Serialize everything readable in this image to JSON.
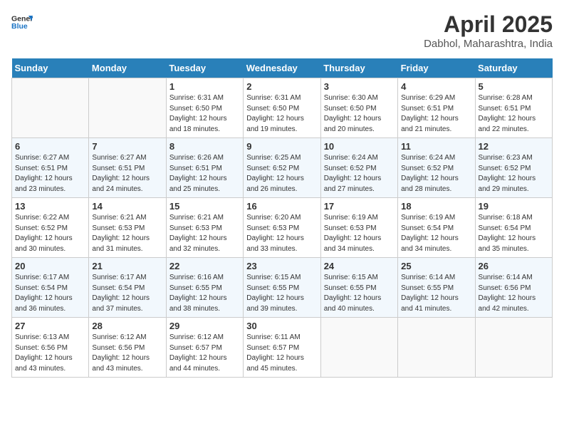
{
  "header": {
    "logo_line1": "General",
    "logo_line2": "Blue",
    "month_title": "April 2025",
    "subtitle": "Dabhol, Maharashtra, India"
  },
  "days_of_week": [
    "Sunday",
    "Monday",
    "Tuesday",
    "Wednesday",
    "Thursday",
    "Friday",
    "Saturday"
  ],
  "weeks": [
    [
      {
        "day": null
      },
      {
        "day": null
      },
      {
        "day": "1",
        "sunrise": "6:31 AM",
        "sunset": "6:50 PM",
        "daylight": "12 hours and 18 minutes."
      },
      {
        "day": "2",
        "sunrise": "6:31 AM",
        "sunset": "6:50 PM",
        "daylight": "12 hours and 19 minutes."
      },
      {
        "day": "3",
        "sunrise": "6:30 AM",
        "sunset": "6:50 PM",
        "daylight": "12 hours and 20 minutes."
      },
      {
        "day": "4",
        "sunrise": "6:29 AM",
        "sunset": "6:51 PM",
        "daylight": "12 hours and 21 minutes."
      },
      {
        "day": "5",
        "sunrise": "6:28 AM",
        "sunset": "6:51 PM",
        "daylight": "12 hours and 22 minutes."
      }
    ],
    [
      {
        "day": "6",
        "sunrise": "6:27 AM",
        "sunset": "6:51 PM",
        "daylight": "12 hours and 23 minutes."
      },
      {
        "day": "7",
        "sunrise": "6:27 AM",
        "sunset": "6:51 PM",
        "daylight": "12 hours and 24 minutes."
      },
      {
        "day": "8",
        "sunrise": "6:26 AM",
        "sunset": "6:51 PM",
        "daylight": "12 hours and 25 minutes."
      },
      {
        "day": "9",
        "sunrise": "6:25 AM",
        "sunset": "6:52 PM",
        "daylight": "12 hours and 26 minutes."
      },
      {
        "day": "10",
        "sunrise": "6:24 AM",
        "sunset": "6:52 PM",
        "daylight": "12 hours and 27 minutes."
      },
      {
        "day": "11",
        "sunrise": "6:24 AM",
        "sunset": "6:52 PM",
        "daylight": "12 hours and 28 minutes."
      },
      {
        "day": "12",
        "sunrise": "6:23 AM",
        "sunset": "6:52 PM",
        "daylight": "12 hours and 29 minutes."
      }
    ],
    [
      {
        "day": "13",
        "sunrise": "6:22 AM",
        "sunset": "6:52 PM",
        "daylight": "12 hours and 30 minutes."
      },
      {
        "day": "14",
        "sunrise": "6:21 AM",
        "sunset": "6:53 PM",
        "daylight": "12 hours and 31 minutes."
      },
      {
        "day": "15",
        "sunrise": "6:21 AM",
        "sunset": "6:53 PM",
        "daylight": "12 hours and 32 minutes."
      },
      {
        "day": "16",
        "sunrise": "6:20 AM",
        "sunset": "6:53 PM",
        "daylight": "12 hours and 33 minutes."
      },
      {
        "day": "17",
        "sunrise": "6:19 AM",
        "sunset": "6:53 PM",
        "daylight": "12 hours and 34 minutes."
      },
      {
        "day": "18",
        "sunrise": "6:19 AM",
        "sunset": "6:54 PM",
        "daylight": "12 hours and 34 minutes."
      },
      {
        "day": "19",
        "sunrise": "6:18 AM",
        "sunset": "6:54 PM",
        "daylight": "12 hours and 35 minutes."
      }
    ],
    [
      {
        "day": "20",
        "sunrise": "6:17 AM",
        "sunset": "6:54 PM",
        "daylight": "12 hours and 36 minutes."
      },
      {
        "day": "21",
        "sunrise": "6:17 AM",
        "sunset": "6:54 PM",
        "daylight": "12 hours and 37 minutes."
      },
      {
        "day": "22",
        "sunrise": "6:16 AM",
        "sunset": "6:55 PM",
        "daylight": "12 hours and 38 minutes."
      },
      {
        "day": "23",
        "sunrise": "6:15 AM",
        "sunset": "6:55 PM",
        "daylight": "12 hours and 39 minutes."
      },
      {
        "day": "24",
        "sunrise": "6:15 AM",
        "sunset": "6:55 PM",
        "daylight": "12 hours and 40 minutes."
      },
      {
        "day": "25",
        "sunrise": "6:14 AM",
        "sunset": "6:55 PM",
        "daylight": "12 hours and 41 minutes."
      },
      {
        "day": "26",
        "sunrise": "6:14 AM",
        "sunset": "6:56 PM",
        "daylight": "12 hours and 42 minutes."
      }
    ],
    [
      {
        "day": "27",
        "sunrise": "6:13 AM",
        "sunset": "6:56 PM",
        "daylight": "12 hours and 43 minutes."
      },
      {
        "day": "28",
        "sunrise": "6:12 AM",
        "sunset": "6:56 PM",
        "daylight": "12 hours and 43 minutes."
      },
      {
        "day": "29",
        "sunrise": "6:12 AM",
        "sunset": "6:57 PM",
        "daylight": "12 hours and 44 minutes."
      },
      {
        "day": "30",
        "sunrise": "6:11 AM",
        "sunset": "6:57 PM",
        "daylight": "12 hours and 45 minutes."
      },
      {
        "day": null
      },
      {
        "day": null
      },
      {
        "day": null
      }
    ]
  ],
  "labels": {
    "sunrise": "Sunrise:",
    "sunset": "Sunset:",
    "daylight": "Daylight:"
  }
}
